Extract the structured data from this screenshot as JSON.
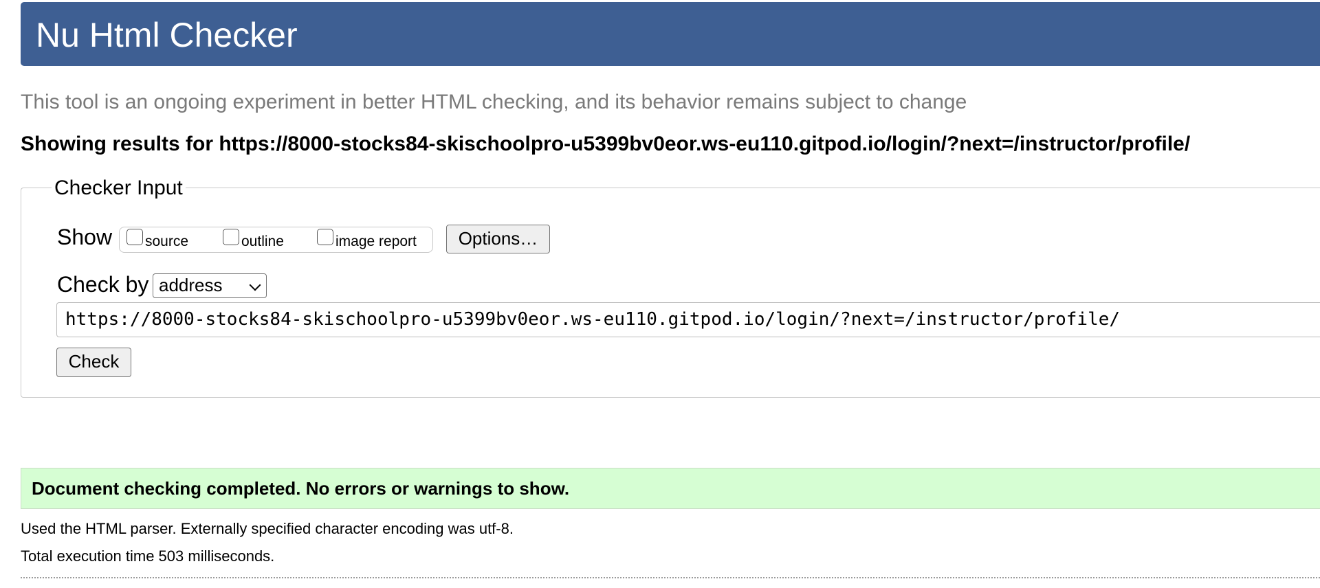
{
  "header": {
    "title": "Nu Html Checker",
    "background_color": "#3e5f93"
  },
  "intro_text": "This tool is an ongoing experiment in better HTML checking, and its behavior remains subject to change",
  "results_heading": "Showing results for https://8000-stocks84-skischoolpro-u5399bv0eor.ws-eu110.gitpod.io/login/?next=/instructor/profile/",
  "checker_input": {
    "legend": "Checker Input",
    "show_label": "Show",
    "show_options": [
      {
        "label": "source",
        "checked": false
      },
      {
        "label": "outline",
        "checked": false
      },
      {
        "label": "image report",
        "checked": false
      }
    ],
    "options_button": "Options…",
    "check_by_label": "Check by",
    "check_by_value": "address",
    "url_value": "https://8000-stocks84-skischoolpro-u5399bv0eor.ws-eu110.gitpod.io/login/?next=/instructor/profile/",
    "check_button": "Check"
  },
  "result": {
    "success_message": "Document checking completed. No errors or warnings to show.",
    "success_color": "#d6fed3",
    "parser_info": "Used the HTML parser. Externally specified character encoding was utf-8.",
    "execution_time": "Total execution time 503 milliseconds."
  }
}
